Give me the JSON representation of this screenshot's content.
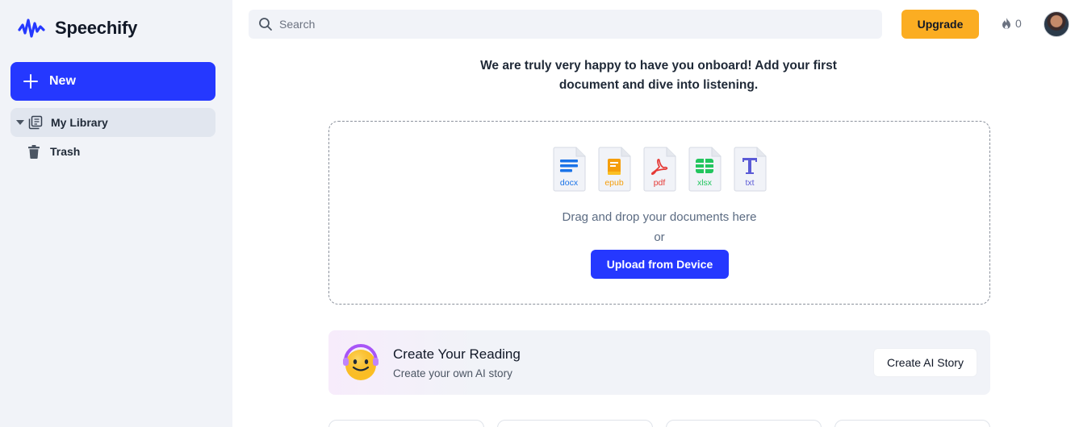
{
  "brand": {
    "name": "Speechify",
    "accent": "#2538ff"
  },
  "sidebar": {
    "new_label": "New",
    "items": [
      {
        "label": "My Library",
        "icon": "library-icon",
        "expanded": true,
        "active": true
      },
      {
        "label": "Trash",
        "icon": "trash-icon"
      }
    ]
  },
  "topbar": {
    "search_placeholder": "Search",
    "upgrade_label": "Upgrade",
    "streak_count": "0"
  },
  "welcome": {
    "line1": "We are truly very happy to have you onboard! Add your first",
    "line2": "document and dive into listening."
  },
  "upload": {
    "file_types": [
      {
        "ext": "docx",
        "color": "#1a73e8",
        "icon": "docx-icon"
      },
      {
        "ext": "epub",
        "color": "#f59e0b",
        "icon": "epub-icon"
      },
      {
        "ext": "pdf",
        "color": "#e53935",
        "icon": "pdf-icon"
      },
      {
        "ext": "xlsx",
        "color": "#22c55e",
        "icon": "xlsx-icon"
      },
      {
        "ext": "txt",
        "color": "#5b5bd6",
        "icon": "txt-icon"
      }
    ],
    "drag_text": "Drag and drop your documents here",
    "or_text": "or",
    "button_label": "Upload from Device"
  },
  "create_reading": {
    "title": "Create Your Reading",
    "subtitle": "Create your own AI story",
    "button_label": "Create AI Story"
  }
}
